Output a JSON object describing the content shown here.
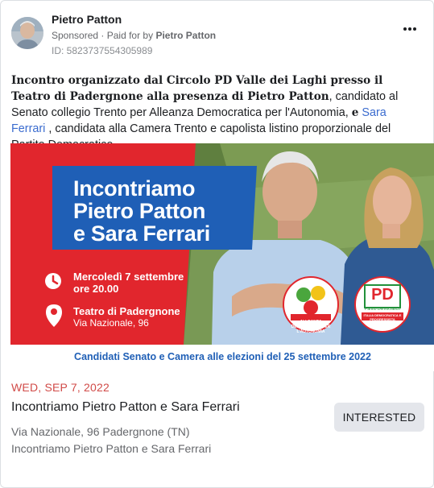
{
  "post": {
    "author": "Pietro Patton",
    "sponsored_label": "Sponsored",
    "paid_for_prefix": "Paid for by",
    "paid_for_name": "Pietro Patton",
    "ad_id": "ID: 5823737554305989",
    "body_bold": "Incontro organizzato dal Circolo PD Valle dei Laghi presso il Teatro di Padergnone alla presenza di Pietro Patton",
    "body_part1": ", candidato al Senato collegio Trento per Alleanza Democratica per l'Autonomia, ",
    "body_e": "e",
    "body_link": "Sara Ferrari",
    "body_part2": " , candidata alla Camera Trento e capolista listino proporzionale del Partito Democratico."
  },
  "banner": {
    "headline_1": "Incontriamo",
    "headline_2": "Pietro Patton",
    "headline_3": "e Sara Ferrari",
    "date_line_1": "Mercoledì 7 settembre",
    "date_line_2": "ore 20.00",
    "venue": "Teatro di Padergnone",
    "address": "Via Nazionale, 96",
    "footer": "Candidati Senato e Camera alle elezioni del 25 settembre 2022",
    "logo_left_text": "ALLEANZA DEMOCRATICA PER L'AUTONOMIA",
    "logo_right_top": "Partito Democratico",
    "logo_right_text": "ITALIA DEMOCRATICA E PROGRESSISTA",
    "logo_pd": "PD"
  },
  "event": {
    "date": "WED, SEP 7, 2022",
    "title": "Incontriamo Pietro Patton e Sara Ferrari",
    "location": "Via Nazionale, 96 Padergnone (TN)",
    "subtitle": "Incontriamo Pietro Patton e Sara Ferrari",
    "button_label": "INTERESTED"
  },
  "colors": {
    "banner_red": "#e1262d",
    "banner_blue": "#1f5fb6",
    "footer_blue": "#1f5fb6",
    "date_red": "#d14b48",
    "link_blue": "#3b6ccf"
  }
}
